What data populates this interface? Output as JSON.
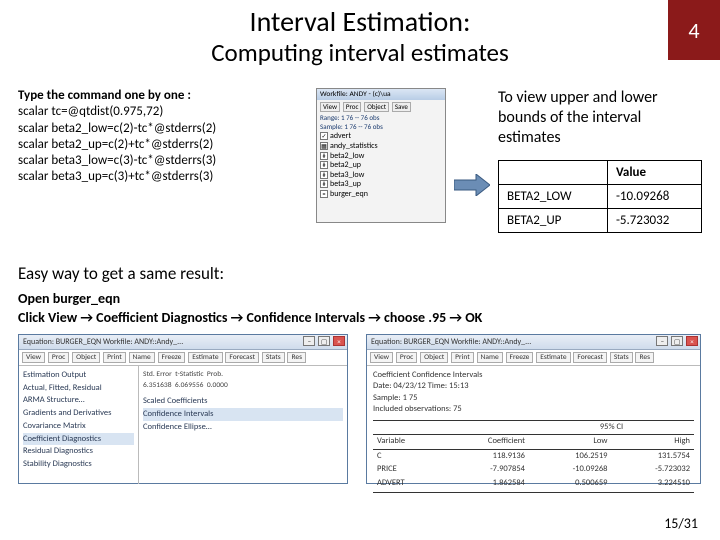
{
  "header": {
    "title_main": "Interval Estimation:",
    "title_sub": "Computing interval estimates",
    "page_number": "4"
  },
  "commands": {
    "label": "Type the command one by one :",
    "lines": [
      "scalar tc=@qtdist(0.975,72)",
      "scalar beta2_low=c(2)-tc*@stderrs(2)",
      "scalar beta2_up=c(2)+tc*@stderrs(2)",
      "scalar beta3_low=c(3)-tc*@stderrs(3)",
      "scalar beta3_up=c(3)+tc*@stderrs(3)"
    ]
  },
  "workfile": {
    "title": "Workfile: ANDY - (c)\\ua",
    "toolbar": [
      "View",
      "Proc",
      "Object",
      "Save"
    ],
    "range": "Range: 1  76  --  76 obs",
    "sample": "Sample: 1  76  --  76 obs",
    "items": [
      "advert",
      "andy_statistics",
      "beta2_low",
      "beta2_up",
      "beta3_low",
      "beta3_up",
      "burger_eqn"
    ]
  },
  "right": {
    "msg": "To view upper and lower bounds of the interval estimates",
    "table": {
      "header_value": "Value",
      "rows": [
        {
          "name": "BETA2_LOW",
          "value": "-10.09268"
        },
        {
          "name": "BETA2_UP",
          "value": "-5.723032"
        }
      ]
    }
  },
  "easy": "Easy way to get a same result:",
  "steps": {
    "l1": "Open burger_eqn",
    "l2": "Click View → Coefficient Diagnostics → Confidence Intervals → choose .95 → OK"
  },
  "winL": {
    "title": "Equation: BURGER_EQN   Workfile: ANDY::Andy_...",
    "toolbar": [
      "View",
      "Proc",
      "Object",
      "Print",
      "Name",
      "Freeze",
      "Estimate",
      "Forecast",
      "Stats",
      "Res"
    ],
    "menu": [
      "Estimation Output",
      "Actual, Fitted, Residual",
      "ARMA Structure…",
      "Gradients and Derivatives",
      "Covariance Matrix",
      "Coefficient Diagnostics",
      "Residual Diagnostics",
      "Stability Diagnostics"
    ],
    "colhdr": [
      "Std. Error",
      "t-Statistic",
      "Prob."
    ],
    "colvals": [
      "6.351638",
      "6.069556",
      "0.0000"
    ],
    "submenu": [
      "Scaled Coefficients",
      "Confidence Intervals",
      "Confidence Ellipse…"
    ]
  },
  "winR": {
    "title": "Equation: BURGER_EQN   Workfile: ANDY::Andy_...",
    "toolbar": [
      "View",
      "Proc",
      "Object",
      "Print",
      "Name",
      "Freeze",
      "Estimate",
      "Forecast",
      "Stats",
      "Res"
    ],
    "meta": [
      "Coefficient Confidence Intervals",
      "Date: 04/23/12   Time: 15:13",
      "Sample: 1 75",
      "Included observations: 75"
    ],
    "table": {
      "grp": "95% CI",
      "headers": [
        "Variable",
        "Coefficient",
        "Low",
        "High"
      ],
      "rows": [
        {
          "v": "C",
          "c": "118.9136",
          "lo": "106.2519",
          "hi": "131.5754"
        },
        {
          "v": "PRICE",
          "c": "-7.907854",
          "lo": "-10.09268",
          "hi": "-5.723032"
        },
        {
          "v": "ADVERT",
          "c": "1.862584",
          "lo": "0.500659",
          "hi": "3.224510"
        }
      ]
    }
  },
  "footer": "15/31"
}
